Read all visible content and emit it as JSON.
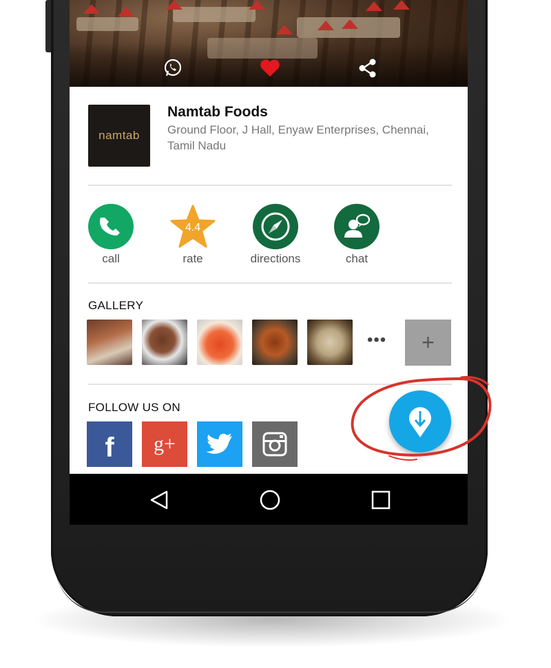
{
  "header": {
    "icons": [
      "whatsapp-icon",
      "heart-icon",
      "share-icon"
    ]
  },
  "business": {
    "logo_text": "namtab",
    "name": "Namtab Foods",
    "address": "Ground Floor, J Hall, Enyaw Enterprises, Chennai, Tamil Nadu"
  },
  "actions": [
    {
      "label": "call",
      "icon": "phone-icon",
      "color": "#12a764"
    },
    {
      "label": "rate",
      "icon": "star-icon",
      "value": "4.4",
      "color": "#f0a52a"
    },
    {
      "label": "directions",
      "icon": "compass-icon",
      "color": "#136a3e"
    },
    {
      "label": "chat",
      "icon": "chat-person-icon",
      "color": "#136a3e"
    }
  ],
  "gallery": {
    "title": "GALLERY",
    "more": "•••",
    "add": "+"
  },
  "follow": {
    "title": "FOLLOW US ON",
    "networks": [
      {
        "name": "facebook",
        "glyph": "f",
        "color": "#3b5998"
      },
      {
        "name": "google-plus",
        "glyph": "g+",
        "color": "#dd4b39"
      },
      {
        "name": "twitter",
        "glyph": "twitter",
        "color": "#1da1f2"
      },
      {
        "name": "instagram",
        "glyph": "camera",
        "color": "#6a6a6a"
      }
    ]
  },
  "fab": {
    "icon": "location-download-icon",
    "color": "#15a6e6"
  },
  "navbar": {
    "icons": [
      "back-icon",
      "home-icon",
      "recents-icon"
    ]
  },
  "annotation_color": "#d6342c"
}
